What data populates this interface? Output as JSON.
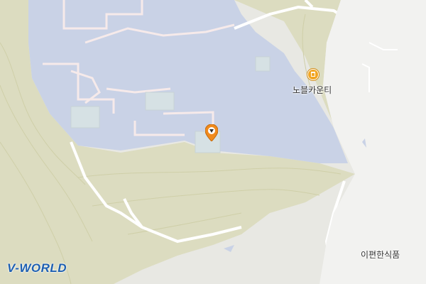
{
  "map": {
    "logo_text": "V-WORLD",
    "colors": {
      "land": "#e8e8e3",
      "forest": "#dcdcc0",
      "reservoir": "#c9d2e6",
      "road": "#ffffff",
      "contour": "#cfcfa8",
      "accent": "#f08a1c"
    },
    "pois": [
      {
        "name": "노블카운티",
        "icon": "building-icon"
      },
      {
        "name": "이편한식품",
        "icon": ""
      }
    ],
    "marker": {
      "icon": "location-pin-icon"
    }
  }
}
